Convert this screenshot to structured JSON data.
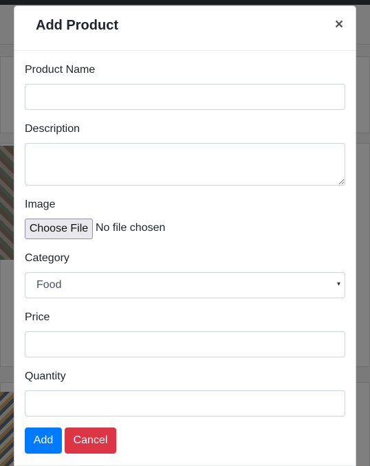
{
  "modal": {
    "title": "Add Product",
    "close_symbol": "×"
  },
  "form": {
    "product_name": {
      "label": "Product Name",
      "value": "",
      "placeholder": ""
    },
    "description": {
      "label": "Description",
      "value": "",
      "placeholder": ""
    },
    "image": {
      "label": "Image",
      "button_label": "Choose File",
      "status": "No file chosen"
    },
    "category": {
      "label": "Category",
      "selected": "Food",
      "caret": "▾"
    },
    "price": {
      "label": "Price",
      "value": "",
      "placeholder": ""
    },
    "quantity": {
      "label": "Quantity",
      "value": "",
      "placeholder": ""
    }
  },
  "actions": {
    "add_label": "Add",
    "cancel_label": "Cancel"
  },
  "colors": {
    "primary": "#007bff",
    "danger": "#dc3545",
    "backdrop": "rgba(0,0,0,0.5)"
  },
  "icons": {
    "close": "close-icon",
    "caret": "chevron-down-icon"
  }
}
